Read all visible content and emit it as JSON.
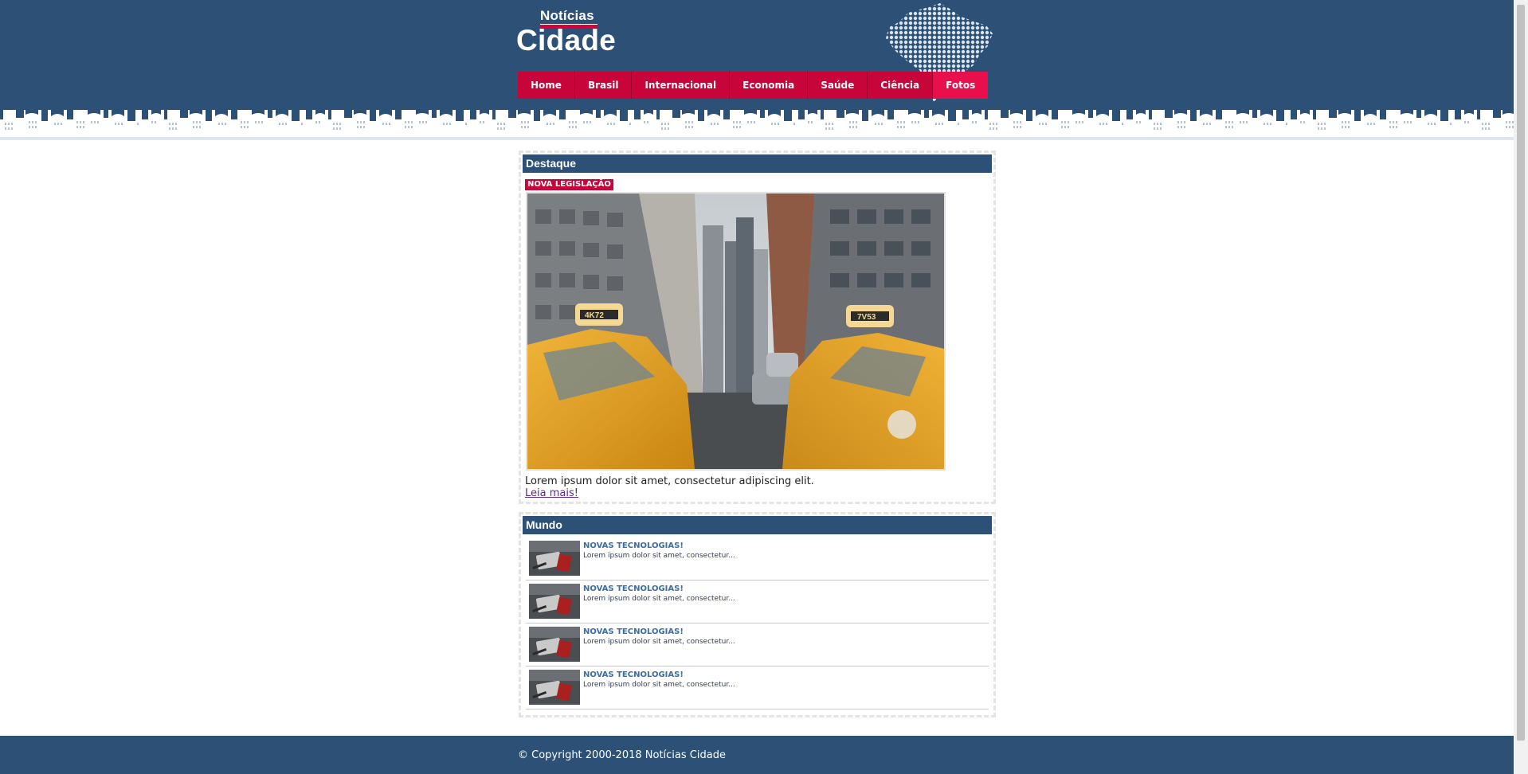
{
  "header": {
    "logo_small": "Notícias",
    "logo_big": "Cidade",
    "nav": [
      {
        "label": "Home"
      },
      {
        "label": "Brasil"
      },
      {
        "label": "Internacional"
      },
      {
        "label": "Economia"
      },
      {
        "label": "Saúde"
      },
      {
        "label": "Ciência"
      },
      {
        "label": "Fotos"
      }
    ]
  },
  "destaque": {
    "title": "Destaque",
    "tag": "NOVA LEGISLAÇÃO",
    "description": "Lorem ipsum dolor sit amet, consectetur adipiscing elit.",
    "link": "Leia mais!",
    "taxi_plates": [
      "4K72",
      "7V53"
    ]
  },
  "mundo": {
    "title": "Mundo",
    "items": [
      {
        "title": "NOVAS TECNOLOGIAS!",
        "excerpt": "Lorem ipsum dolor sit amet, consectetur..."
      },
      {
        "title": "NOVAS TECNOLOGIAS!",
        "excerpt": "Lorem ipsum dolor sit amet, consectetur..."
      },
      {
        "title": "NOVAS TECNOLOGIAS!",
        "excerpt": "Lorem ipsum dolor sit amet, consectetur..."
      },
      {
        "title": "NOVAS TECNOLOGIAS!",
        "excerpt": "Lorem ipsum dolor sit amet, consectetur..."
      }
    ]
  },
  "footer": {
    "copyright": "© Copyright 2000-2018 Notícias Cidade"
  },
  "colors": {
    "brand_blue": "#2c5076",
    "nav_red": "#c8053a",
    "nav_active": "#e80f4c"
  },
  "icons": [
    "brazil-map-icon",
    "city-skyline-icon"
  ]
}
